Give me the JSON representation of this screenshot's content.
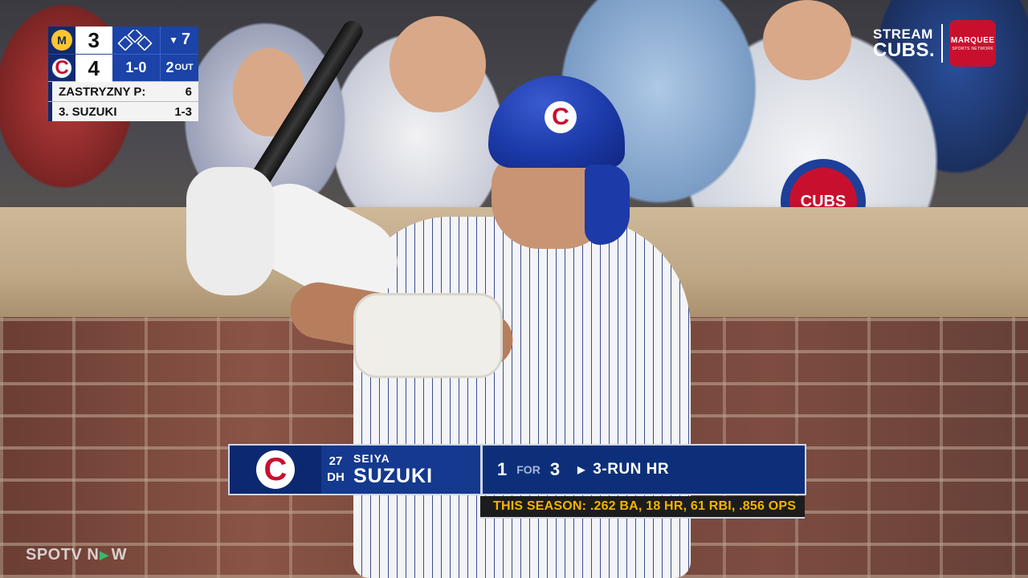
{
  "scorebug": {
    "away_team_icon": "brewers-logo",
    "home_team_icon": "cubs-logo",
    "away_score": "3",
    "home_score": "4",
    "count": "1-0",
    "inning_arrow": "▼",
    "inning": "7",
    "outs_number": "2",
    "outs_label": "OUT",
    "bases_occupied": [],
    "pitcher_label": "ZASTRYZNY P:",
    "pitch_count": "6",
    "batter_label": "3. SUZUKI",
    "batter_line": "1-3"
  },
  "network": {
    "line1": "STREAM",
    "line2": "CUBS.",
    "logo_name": "MARQUEE",
    "logo_sub": "SPORTS NETWORK"
  },
  "lower_third": {
    "team_logo": "C",
    "number": "27",
    "position": "DH",
    "first_name": "SEIYA",
    "last_name": "SUZUKI",
    "hits": "1",
    "for_label": "FOR",
    "at_bats": "3",
    "result": "3-RUN HR",
    "season_line": "THIS SEASON: .262 BA, 18 HR, 61 RBI, .856 OPS"
  },
  "watermark": {
    "part1": "SPOTV N",
    "part2": "W"
  },
  "colors": {
    "cubs_blue": "#0e3386",
    "cubs_red": "#c8102e",
    "season_text": "#f4b400",
    "brewers_gold": "#ffc52f"
  }
}
